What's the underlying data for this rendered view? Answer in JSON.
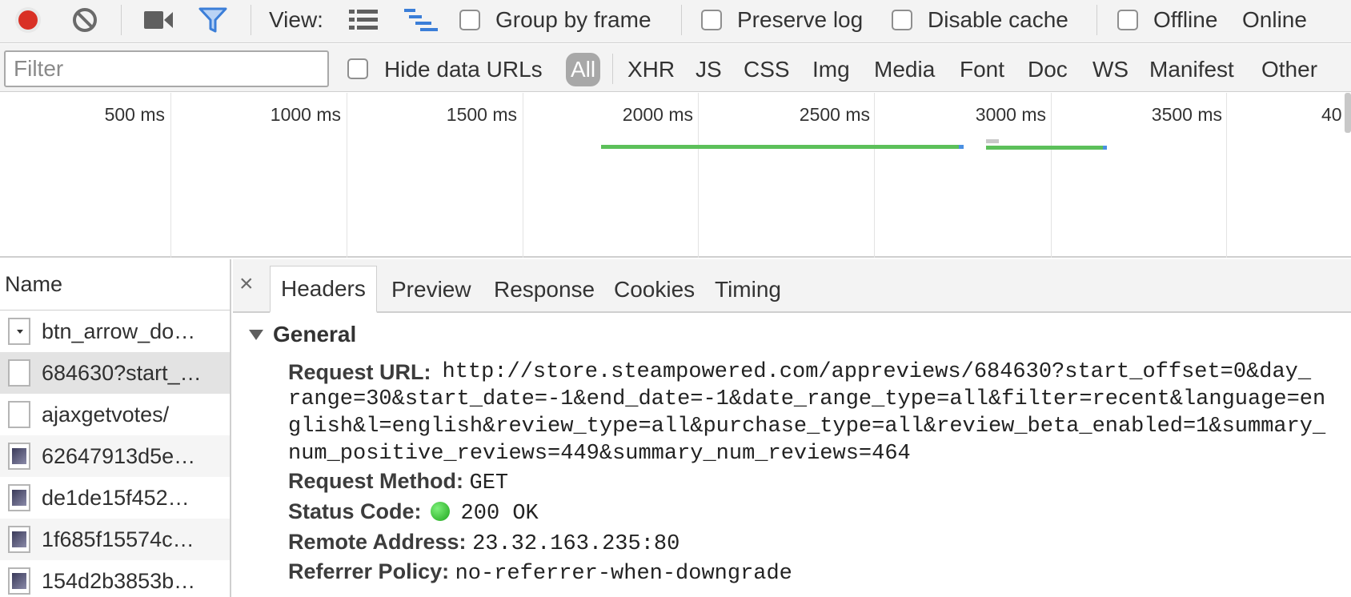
{
  "toolbar": {
    "view_label": "View:",
    "group_by_frame": "Group by frame",
    "preserve_log": "Preserve log",
    "disable_cache": "Disable cache",
    "offline": "Offline",
    "online": "Online",
    "icons": [
      "record-icon",
      "clear-icon",
      "camera-icon",
      "filter-icon",
      "large-rows-icon",
      "waterfall-icon"
    ]
  },
  "filter": {
    "placeholder": "Filter",
    "hide_data_urls": "Hide data URLs",
    "types": [
      "All",
      "XHR",
      "JS",
      "CSS",
      "Img",
      "Media",
      "Font",
      "Doc",
      "WS",
      "Manifest",
      "Other"
    ],
    "selected_type": "All"
  },
  "overview": {
    "ticks": [
      "500 ms",
      "1000 ms",
      "1500 ms",
      "2000 ms",
      "2500 ms",
      "3000 ms",
      "3500 ms",
      "40"
    ]
  },
  "name_column": {
    "header": "Name",
    "rows": [
      {
        "name": "btn_arrow_do…",
        "icon": "arrow-file-icon"
      },
      {
        "name": "684630?start_…",
        "icon": "document-icon"
      },
      {
        "name": "ajaxgetvotes/",
        "icon": "document-icon"
      },
      {
        "name": "62647913d5e…",
        "icon": "image-thumbnail-icon"
      },
      {
        "name": "de1de15f452…",
        "icon": "image-thumbnail-icon"
      },
      {
        "name": "1f685f15574c…",
        "icon": "image-thumbnail-icon"
      },
      {
        "name": "154d2b3853b…",
        "icon": "image-thumbnail-icon"
      }
    ]
  },
  "details": {
    "close": "×",
    "tabs": [
      "Headers",
      "Preview",
      "Response",
      "Cookies",
      "Timing"
    ],
    "active_tab": "Headers",
    "general_title": "General",
    "request_url_key": "Request URL:",
    "request_url_lines": [
      "http://store.steampowered.com/appreviews/684630?start_offset=0&day_",
      "range=30&start_date=-1&end_date=-1&date_range_type=all&filter=recent&language=en",
      "glish&l=english&review_type=all&purchase_type=all&review_beta_enabled=1&summary_",
      "num_positive_reviews=449&summary_num_reviews=464"
    ],
    "request_method_key": "Request Method:",
    "request_method": "GET",
    "status_code_key": "Status Code:",
    "status_code": "200 OK",
    "status_color": "#1ea51b",
    "remote_address_key": "Remote Address:",
    "remote_address": "23.32.163.235:80",
    "referrer_policy_key": "Referrer Policy:",
    "referrer_policy": "no-referrer-when-downgrade"
  }
}
